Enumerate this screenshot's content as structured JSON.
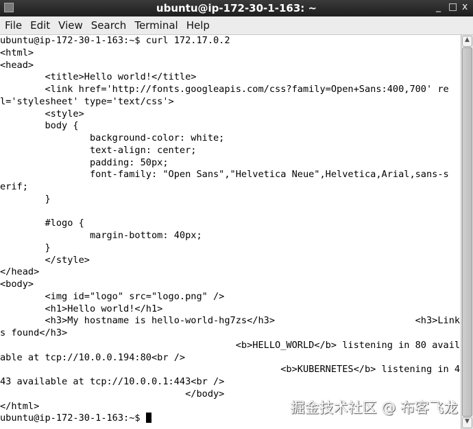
{
  "window": {
    "title": "ubuntu@ip-172-30-1-163: ~",
    "minimize": "_",
    "maximize": "□",
    "close": "x"
  },
  "menu": [
    "File",
    "Edit",
    "View",
    "Search",
    "Terminal",
    "Help"
  ],
  "terminal": {
    "lines": [
      "ubuntu@ip-172-30-1-163:~$ curl 172.17.0.2",
      "<html>",
      "<head>",
      "        <title>Hello world!</title>",
      "        <link href='http://fonts.googleapis.com/css?family=Open+Sans:400,700' re",
      "l='stylesheet' type='text/css'>",
      "        <style>",
      "        body {",
      "                background-color: white;",
      "                text-align: center;",
      "                padding: 50px;",
      "                font-family: \"Open Sans\",\"Helvetica Neue\",Helvetica,Arial,sans-s",
      "erif;",
      "        }",
      "",
      "        #logo {",
      "                margin-bottom: 40px;",
      "        }",
      "        </style>",
      "</head>",
      "<body>",
      "        <img id=\"logo\" src=\"logo.png\" />",
      "        <h1>Hello world!</h1>",
      "        <h3>My hostname is hello-world-hg7zs</h3>                         <h3>Link",
      "s found</h3>",
      "                                          <b>HELLO_WORLD</b> listening in 80 avail",
      "able at tcp://10.0.0.194:80<br />",
      "                                                  <b>KUBERNETES</b> listening in 4",
      "43 available at tcp://10.0.0.1:443<br />",
      "                                 </body>",
      "</html>"
    ],
    "prompt": "ubuntu@ip-172-30-1-163:~$ "
  },
  "watermark": "掘金技术社区 @ 布客飞龙"
}
